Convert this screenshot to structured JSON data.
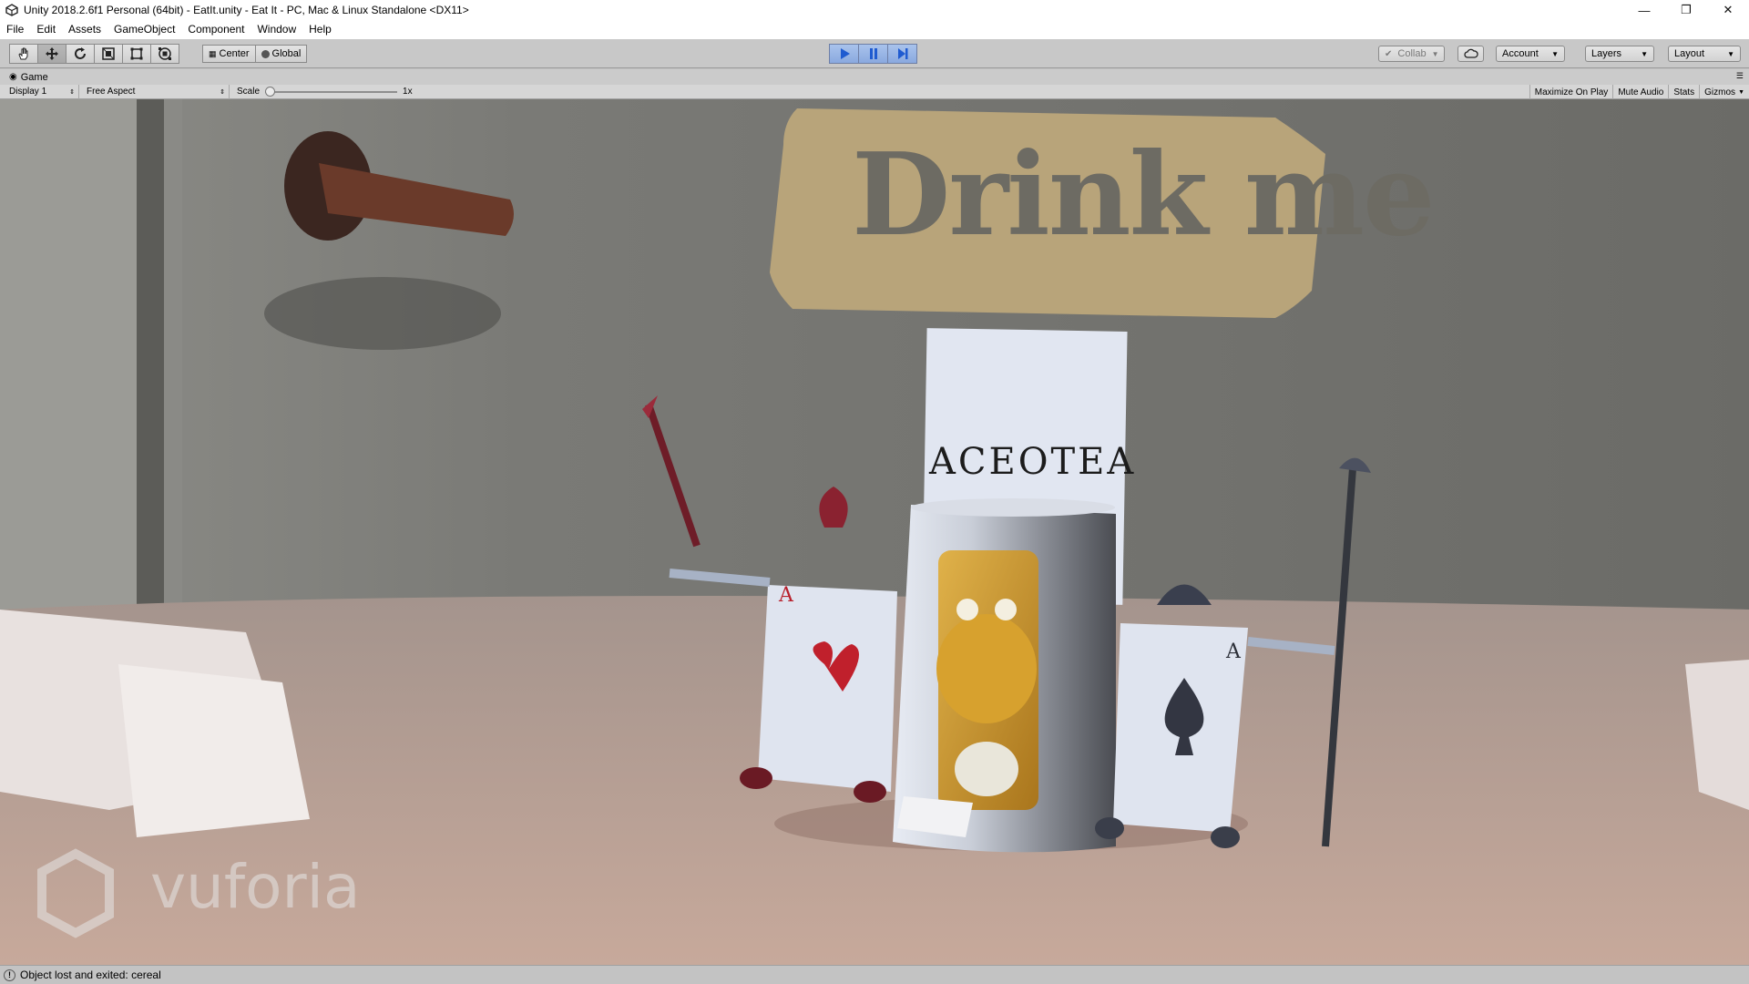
{
  "window": {
    "title": "Unity 2018.2.6f1 Personal (64bit) - EatIt.unity - Eat It - PC, Mac & Linux Standalone <DX11>",
    "controls": [
      "minimize-icon",
      "restore-icon",
      "close-icon"
    ]
  },
  "menu": {
    "items": [
      "File",
      "Edit",
      "Assets",
      "GameObject",
      "Component",
      "Window",
      "Help"
    ]
  },
  "toolbar": {
    "tools": [
      "hand-tool-icon",
      "move-tool-icon",
      "rotate-tool-icon",
      "scale-tool-icon",
      "rect-tool-icon",
      "transform-tool-icon"
    ],
    "pivot_mode": "Center",
    "pivot_rotation": "Global",
    "playing": true,
    "paused": true,
    "collab_label": "Collab",
    "account_label": "Account",
    "layers_label": "Layers",
    "layout_label": "Layout",
    "accent_color": "#3d6fd6"
  },
  "game_panel": {
    "tab_label": "Game",
    "display": "Display 1",
    "aspect": "Free Aspect",
    "scale_label": "Scale",
    "scale_value": "1x",
    "maximize_on_play": "Maximize On Play",
    "mute_audio": "Mute Audio",
    "stats": "Stats",
    "gizmos": "Gizmos"
  },
  "scene": {
    "sign_text": "Drink me",
    "cup_text": "ACEOTEA",
    "card_rank": "A",
    "watermark": "vuforia"
  },
  "status": {
    "message": "Object lost and exited: cereal"
  }
}
